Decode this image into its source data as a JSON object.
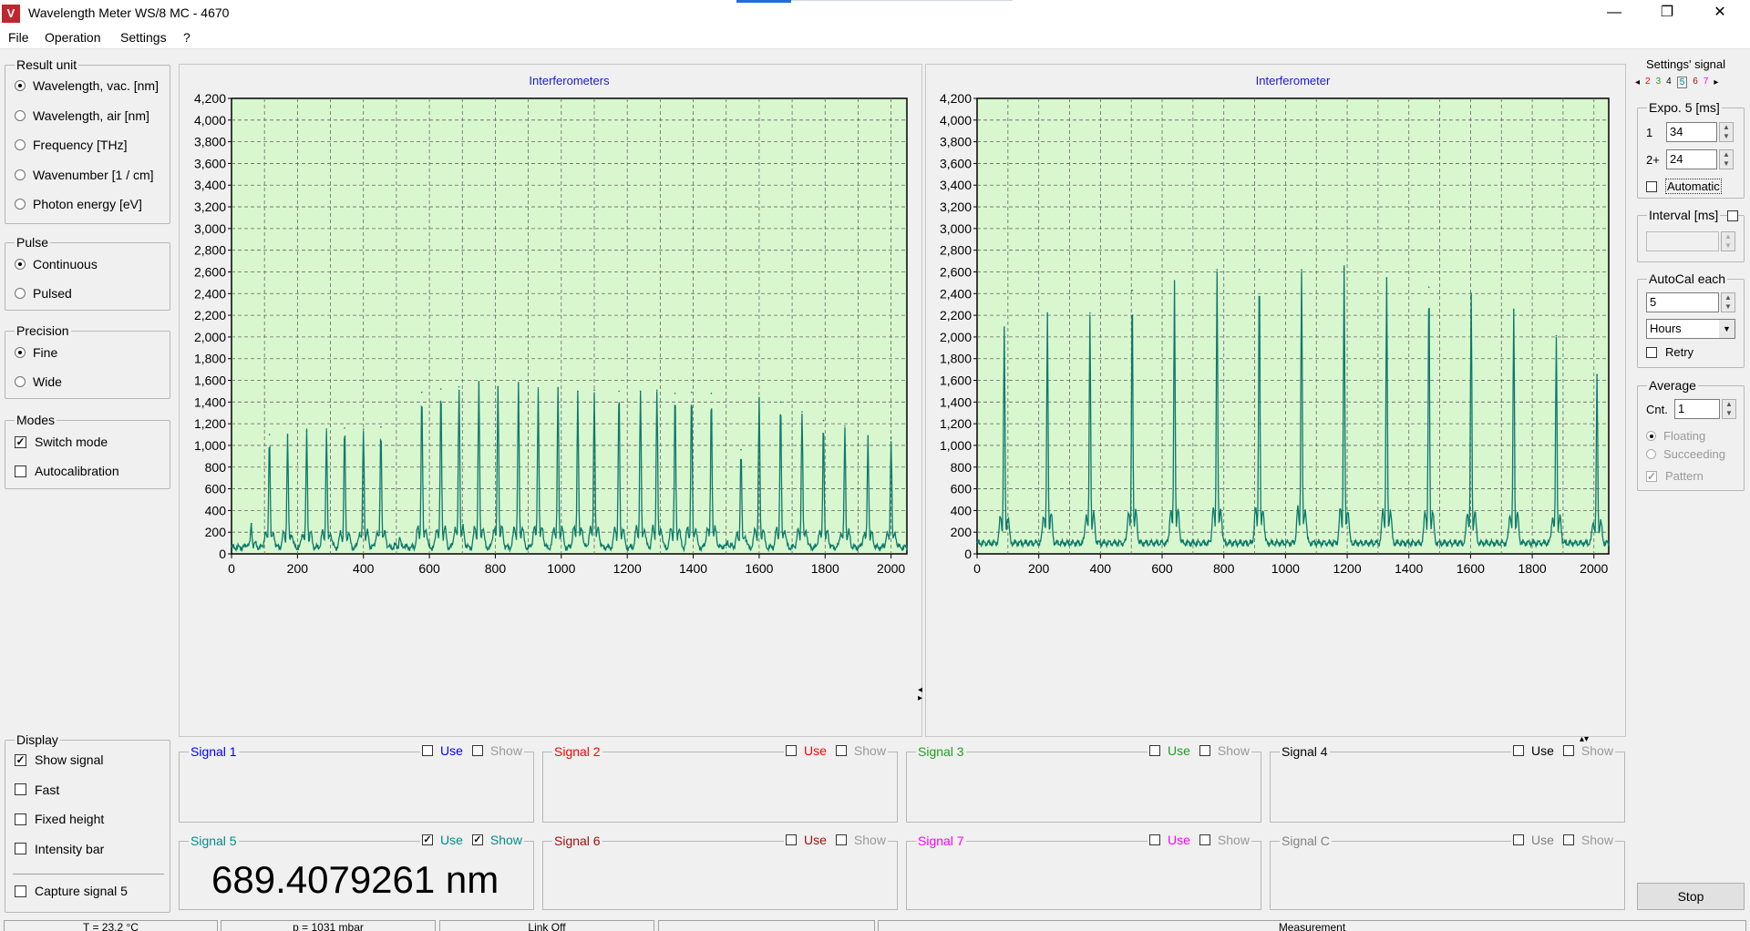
{
  "window": {
    "title": "Wavelength Meter WS/8 MC - 4670",
    "logo_letter": "V",
    "minimize": "—",
    "restore": "❐",
    "close": "✕"
  },
  "menu": [
    "File",
    "Operation",
    "Settings",
    "?"
  ],
  "left_panel": {
    "result_unit": {
      "title": "Result unit",
      "options": [
        "Wavelength, vac. [nm]",
        "Wavelength, air [nm]",
        "Frequency [THz]",
        "Wavenumber [1 / cm]",
        "Photon energy [eV]"
      ],
      "selected": 0
    },
    "pulse": {
      "title": "Pulse",
      "options": [
        "Continuous",
        "Pulsed"
      ],
      "selected": 0
    },
    "precision": {
      "title": "Precision",
      "options": [
        "Fine",
        "Wide"
      ],
      "selected": 0
    },
    "modes": {
      "title": "Modes",
      "options": [
        "Switch mode",
        "Autocalibration"
      ],
      "checked": [
        true,
        false
      ]
    },
    "display": {
      "title": "Display",
      "options": [
        "Show signal",
        "Fast",
        "Fixed height",
        "Intensity bar"
      ],
      "checked": [
        true,
        false,
        false,
        false
      ],
      "capture_label": "Capture signal 5",
      "capture_checked": false
    }
  },
  "charts": [
    {
      "title": "Interferometers",
      "type": "line",
      "xlim": [
        0,
        2048
      ],
      "ylim": [
        0,
        4200
      ],
      "xticks": [
        "0",
        "200",
        "400",
        "600",
        "800",
        "1000",
        "1200",
        "1400",
        "1600",
        "1800",
        "2000"
      ],
      "yticks": [
        "0",
        "200",
        "400",
        "600",
        "800",
        "1,000",
        "1,200",
        "1,400",
        "1,600",
        "1,800",
        "2,000",
        "2,200",
        "2,400",
        "2,600",
        "2,800",
        "3,000",
        "3,200",
        "3,400",
        "3,600",
        "3,800",
        "4,000",
        "4,200"
      ],
      "baseline": 60,
      "peaks": [
        [
          60,
          280
        ],
        [
          115,
          1100
        ],
        [
          170,
          1090
        ],
        [
          228,
          1130
        ],
        [
          288,
          1150
        ],
        [
          343,
          1160
        ],
        [
          400,
          1150
        ],
        [
          453,
          1170
        ],
        [
          510,
          150
        ],
        [
          577,
          1490
        ],
        [
          635,
          1520
        ],
        [
          690,
          1540
        ],
        [
          750,
          1560
        ],
        [
          808,
          1540
        ],
        [
          870,
          1560
        ],
        [
          930,
          1530
        ],
        [
          990,
          1530
        ],
        [
          1050,
          1500
        ],
        [
          1100,
          1510
        ],
        [
          1175,
          1500
        ],
        [
          1240,
          1500
        ],
        [
          1290,
          1510
        ],
        [
          1345,
          1480
        ],
        [
          1395,
          1490
        ],
        [
          1455,
          1480
        ],
        [
          1505,
          120
        ],
        [
          1545,
          960
        ],
        [
          1600,
          1420
        ],
        [
          1665,
          1400
        ],
        [
          1730,
          1310
        ],
        [
          1795,
          1230
        ],
        [
          1860,
          1180
        ],
        [
          1930,
          1090
        ],
        [
          2000,
          1070
        ]
      ]
    },
    {
      "title": "Interferometer",
      "type": "line",
      "xlim": [
        0,
        2048
      ],
      "ylim": [
        0,
        4200
      ],
      "xticks": [
        "0",
        "200",
        "400",
        "600",
        "800",
        "1000",
        "1200",
        "1400",
        "1600",
        "1800",
        "2000"
      ],
      "yticks": [
        "0",
        "200",
        "400",
        "600",
        "800",
        "1,000",
        "1,200",
        "1,400",
        "1,600",
        "1,800",
        "2,000",
        "2,200",
        "2,400",
        "2,600",
        "2,800",
        "3,000",
        "3,200",
        "3,400",
        "3,600",
        "3,800",
        "4,000",
        "4,200"
      ],
      "baseline": 100,
      "peaks": [
        [
          88,
          2060
        ],
        [
          228,
          2200
        ],
        [
          366,
          2220
        ],
        [
          503,
          2430
        ],
        [
          640,
          2520
        ],
        [
          778,
          2620
        ],
        [
          915,
          2620
        ],
        [
          1052,
          2620
        ],
        [
          1190,
          2630
        ],
        [
          1328,
          2540
        ],
        [
          1465,
          2460
        ],
        [
          1602,
          2380
        ],
        [
          1740,
          2250
        ],
        [
          1878,
          2010
        ],
        [
          2010,
          1650
        ]
      ]
    }
  ],
  "signals": [
    {
      "name": "Signal 1",
      "color": "#0000ff",
      "use": false,
      "show": false,
      "value": "",
      "use_label": "Use",
      "show_label": "Show"
    },
    {
      "name": "Signal 2",
      "color": "#ff0000",
      "use": false,
      "show": false,
      "value": "",
      "use_label": "Use",
      "show_label": "Show"
    },
    {
      "name": "Signal 3",
      "color": "#1ea01e",
      "use": false,
      "show": false,
      "value": "",
      "use_label": "Use",
      "show_label": "Show"
    },
    {
      "name": "Signal 4",
      "color": "#000000",
      "use": false,
      "show": false,
      "value": "",
      "use_label": "Use",
      "show_label": "Show"
    },
    {
      "name": "Signal 5",
      "color": "#008b8b",
      "use": true,
      "show": true,
      "value": "689.4079261 nm",
      "use_label": "Use",
      "show_label": "Show"
    },
    {
      "name": "Signal 6",
      "color": "#a01010",
      "use": false,
      "show": false,
      "value": "",
      "use_label": "Use",
      "show_label": "Show"
    },
    {
      "name": "Signal 7",
      "color": "#ff00ff",
      "use": false,
      "show": false,
      "value": "",
      "use_label": "Use",
      "show_label": "Show"
    },
    {
      "name": "Signal C",
      "color": "#808080",
      "use": false,
      "show": false,
      "value": "",
      "use_label": "Use",
      "show_label": "Show"
    }
  ],
  "right_panel": {
    "settings_signal": "Settings' signal",
    "signal_tabs": [
      {
        "label": "2",
        "color": "#ff0000"
      },
      {
        "label": "3",
        "color": "#1ea01e"
      },
      {
        "label": "4",
        "color": "#000000"
      },
      {
        "label": "5",
        "color": "#008b8b"
      },
      {
        "label": "6",
        "color": "#a01010"
      },
      {
        "label": "7",
        "color": "#ff00ff"
      }
    ],
    "expo_title": "Expo. 5 [ms]",
    "expo1_label": "1",
    "expo1_value": "34",
    "expo2_label": "2+",
    "expo2_value": "24",
    "automatic_label": "Automatic",
    "interval_title": "Interval [ms]",
    "autocal_title": "AutoCal each",
    "autocal_value": "5",
    "autocal_unit": "Hours",
    "retry_label": "Retry",
    "average_title": "Average",
    "cnt_label": "Cnt.",
    "cnt_value": "1",
    "floating": "Floating",
    "succeeding": "Succeeding",
    "pattern": "Pattern",
    "stop_button": "Stop"
  },
  "statusbar": {
    "temperature": "T = 23.2 °C",
    "pressure": "p = 1031 mbar",
    "link": "Link Off",
    "empty": "",
    "state": "Measurement"
  }
}
